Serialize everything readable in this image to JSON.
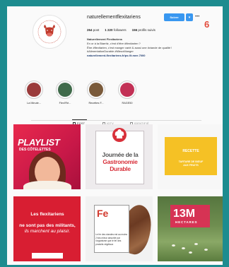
{
  "profile": {
    "username": "naturellementflexitariens",
    "follow_label": "Suivre",
    "badge_number": "6",
    "stats": [
      {
        "value": "264",
        "label": "post"
      },
      {
        "value": "1 220",
        "label": "followers"
      },
      {
        "value": "156",
        "label": "profils suivis"
      }
    ],
    "bio": {
      "name": "Naturellement Flexitariens",
      "lines": [
        "En or à la Biarritz, c'est d'être #flexitarien ?",
        "Être #flexitarien, c'est manger varié & aussi une #viande de qualité !",
        "#AlimentationDurable #MieuxManger"
      ],
      "link": "naturellement-flexitariens.fr/ps://t.mee.7000"
    }
  },
  "highlights": [
    {
      "label": "La Minute...",
      "color": "#9a3b3b"
    },
    {
      "label": "Flexi'Ré...",
      "color": "#3f6a4a"
    },
    {
      "label": "Recettes F...",
      "color": "#7a5a3a"
    },
    {
      "label": "RAGE50",
      "color": "#c23055"
    }
  ],
  "tabs": [
    {
      "label": "POST",
      "active": true
    },
    {
      "label": "IGTV",
      "active": false
    },
    {
      "label": "IDENTIFIÉ",
      "active": false
    }
  ],
  "posts": {
    "p1": {
      "big": "PLAYLIST",
      "small": "DES CÔTELETTES"
    },
    "p2": {
      "line1": "Journée de la",
      "line2": "Gastronomie",
      "line3": "Durable"
    },
    "p3": {
      "title": "RECETTE",
      "subtitle_1": "TARTARE DE BŒUF",
      "subtitle_2": "AUX FRUITS"
    },
    "p4": {
      "line1": "Les flexitariens",
      "line2": "ne sont pas des militants,",
      "line3": "ils marchent au plaisir."
    },
    "p5": {
      "big": "Fe",
      "desc": "Le fer des viandes est au moins 2 fois mieux absorbé par l'organisme que le fer des produits végétaux"
    },
    "p6": {
      "big": "13M",
      "small": "HECTARES"
    }
  },
  "colors": {
    "background": "#1d8c8f",
    "accent_blue": "#3897f0",
    "brand_red": "#d8303a",
    "yellow": "#f5c125"
  }
}
